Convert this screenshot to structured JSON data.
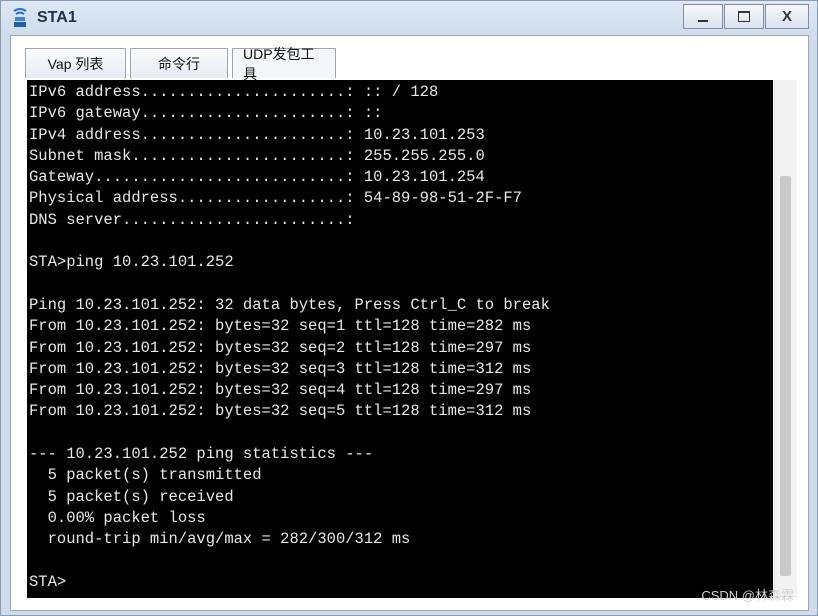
{
  "window": {
    "title": "STA1"
  },
  "titlebar_buttons": {
    "minimize": "",
    "maximize": "",
    "close": "X"
  },
  "tabs": [
    {
      "label": "Vap 列表"
    },
    {
      "label": "命令行"
    },
    {
      "label": "UDP发包工具"
    }
  ],
  "terminal": {
    "lines": [
      "IPv6 address......................: :: / 128",
      "IPv6 gateway......................: ::",
      "IPv4 address......................: 10.23.101.253",
      "Subnet mask.......................: 255.255.255.0",
      "Gateway...........................: 10.23.101.254",
      "Physical address..................: 54-89-98-51-2F-F7",
      "DNS server........................:",
      "",
      "STA>ping 10.23.101.252",
      "",
      "Ping 10.23.101.252: 32 data bytes, Press Ctrl_C to break",
      "From 10.23.101.252: bytes=32 seq=1 ttl=128 time=282 ms",
      "From 10.23.101.252: bytes=32 seq=2 ttl=128 time=297 ms",
      "From 10.23.101.252: bytes=32 seq=3 ttl=128 time=312 ms",
      "From 10.23.101.252: bytes=32 seq=4 ttl=128 time=297 ms",
      "From 10.23.101.252: bytes=32 seq=5 ttl=128 time=312 ms",
      "",
      "--- 10.23.101.252 ping statistics ---",
      "  5 packet(s) transmitted",
      "  5 packet(s) received",
      "  0.00% packet loss",
      "  round-trip min/avg/max = 282/300/312 ms",
      "",
      "STA>"
    ]
  },
  "watermark": "CSDN @林森霖"
}
